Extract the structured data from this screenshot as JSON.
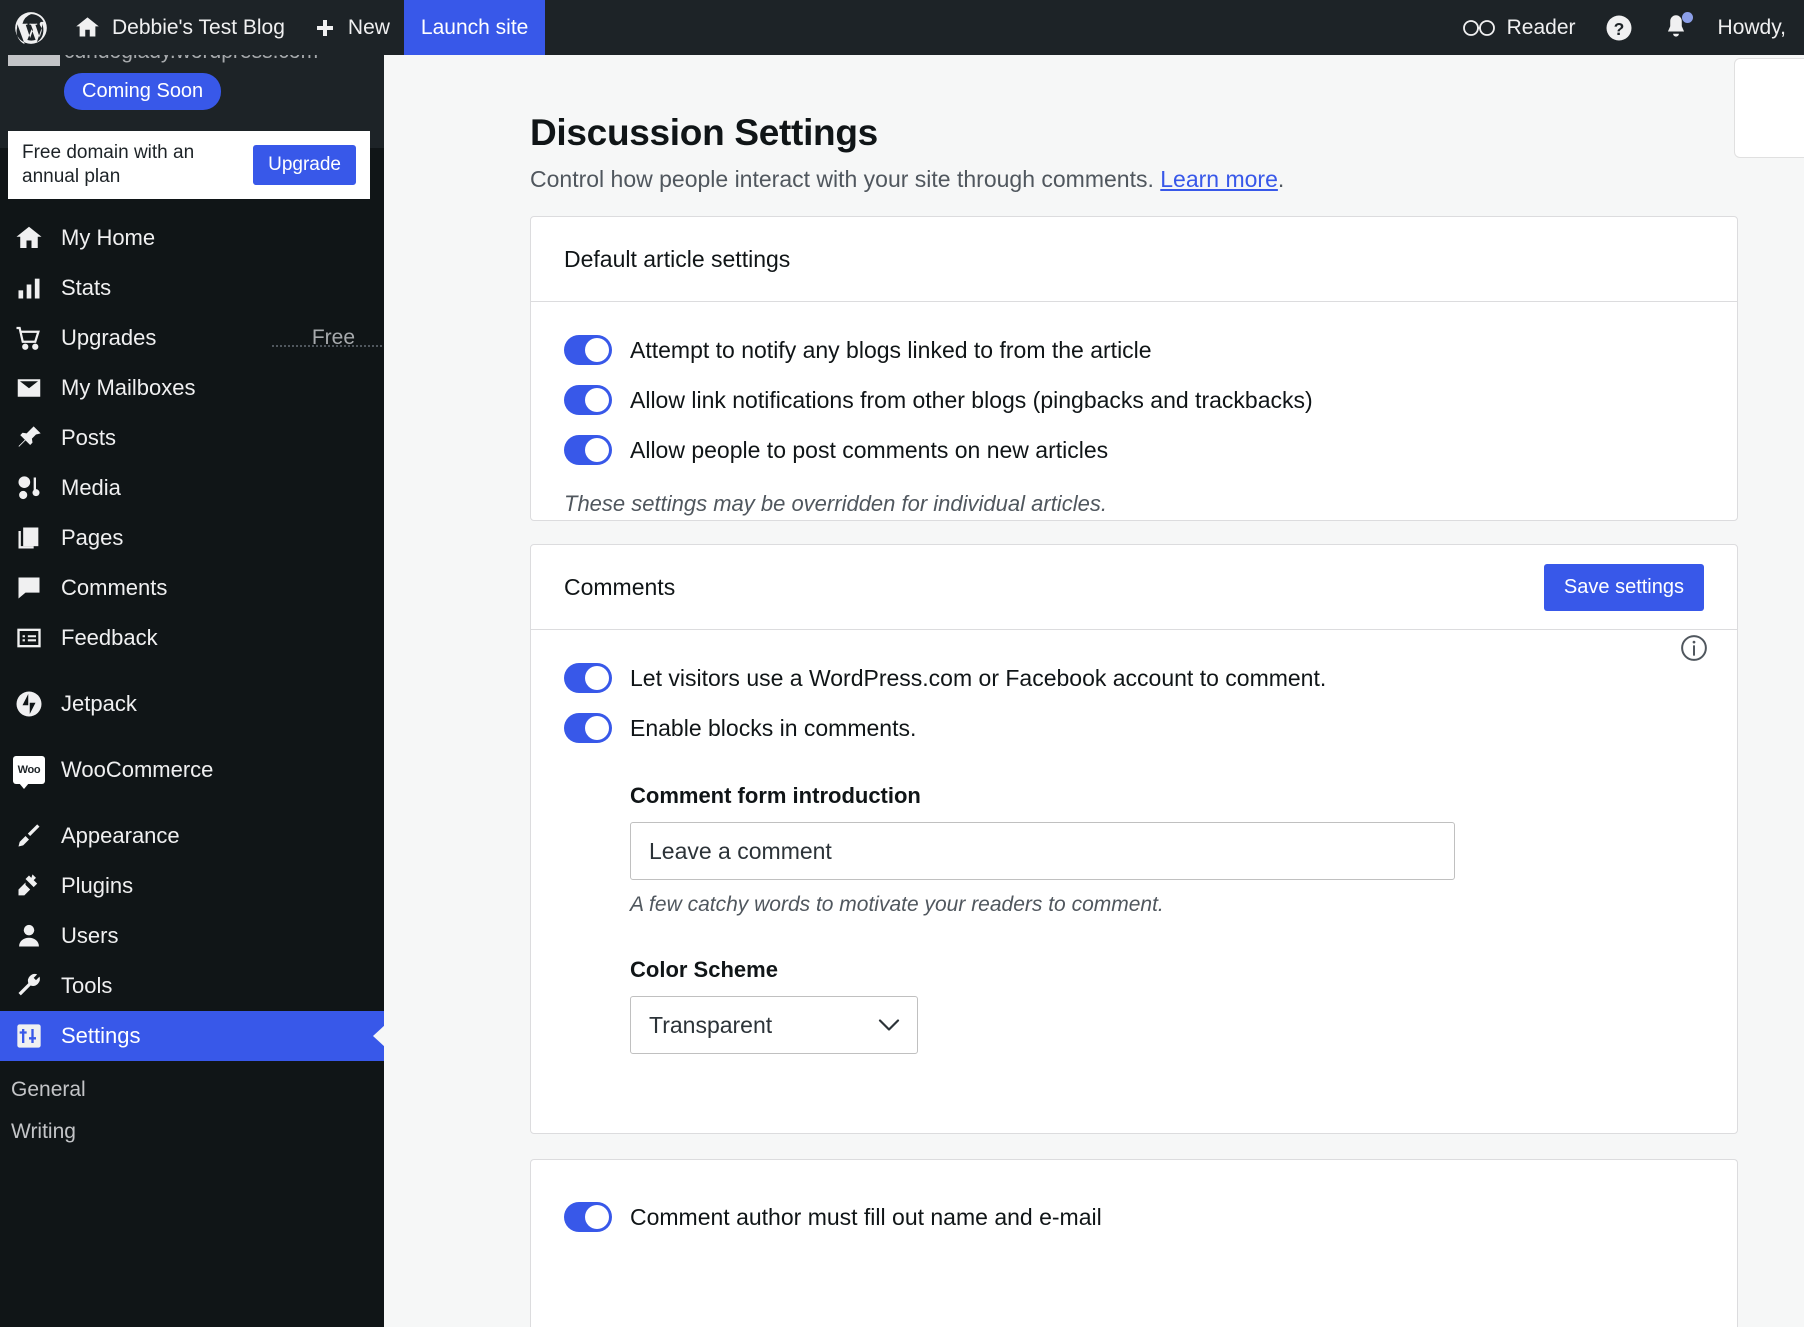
{
  "adminbar": {
    "wp_logo": "wordpress-logo",
    "site_name": "Debbie's Test Blog",
    "new_label": "New",
    "launch_label": "Launch site",
    "reader_label": "Reader",
    "howdy_label": "Howdy,"
  },
  "sidebar": {
    "site_url": "cdndoglady.wordpress.com",
    "coming_soon": "Coming Soon",
    "promo": {
      "text": "Free domain with an annual plan",
      "button": "Upgrade"
    },
    "items": [
      {
        "label": "My Home",
        "icon": "home-icon",
        "count": ""
      },
      {
        "label": "Stats",
        "icon": "stats-icon",
        "count": ""
      },
      {
        "label": "Upgrades",
        "icon": "cart-icon",
        "count": "Free"
      },
      {
        "label": "My Mailboxes",
        "icon": "mail-icon",
        "count": ""
      },
      {
        "label": "Posts",
        "icon": "pin-icon",
        "count": ""
      },
      {
        "label": "Media",
        "icon": "media-icon",
        "count": ""
      },
      {
        "label": "Pages",
        "icon": "pages-icon",
        "count": ""
      },
      {
        "label": "Comments",
        "icon": "comment-icon",
        "count": ""
      },
      {
        "label": "Feedback",
        "icon": "feedback-icon",
        "count": ""
      },
      {
        "label": "Jetpack",
        "icon": "jetpack-icon",
        "count": ""
      },
      {
        "label": "WooCommerce",
        "icon": "woo-icon",
        "count": ""
      },
      {
        "label": "Appearance",
        "icon": "brush-icon",
        "count": ""
      },
      {
        "label": "Plugins",
        "icon": "plug-icon",
        "count": ""
      },
      {
        "label": "Users",
        "icon": "user-icon",
        "count": ""
      },
      {
        "label": "Tools",
        "icon": "wrench-icon",
        "count": ""
      },
      {
        "label": "Settings",
        "icon": "settings-icon",
        "count": ""
      }
    ],
    "submenu": [
      {
        "label": "General"
      },
      {
        "label": "Writing"
      }
    ]
  },
  "page": {
    "title": "Discussion Settings",
    "subtitle": "Control how people interact with your site through comments.",
    "learn_more": "Learn more",
    "subtitle_period": "."
  },
  "default_article": {
    "heading": "Default article settings",
    "toggles": [
      {
        "label": "Attempt to notify any blogs linked to from the article",
        "on": true
      },
      {
        "label": "Allow link notifications from other blogs (pingbacks and trackbacks)",
        "on": true
      },
      {
        "label": "Allow people to post comments on new articles",
        "on": true
      }
    ],
    "note": "These settings may be overridden for individual articles."
  },
  "comments": {
    "heading": "Comments",
    "save_label": "Save settings",
    "info_icon": "info-icon",
    "toggles": [
      {
        "label": "Let visitors use a WordPress.com or Facebook account to comment.",
        "on": true
      },
      {
        "label": "Enable blocks in comments.",
        "on": true
      }
    ],
    "form_intro": {
      "label": "Comment form introduction",
      "value": "Leave a comment",
      "placeholder": "Leave a comment",
      "help": "A few catchy words to motivate your readers to comment."
    },
    "color_scheme": {
      "label": "Color Scheme",
      "selected": "Transparent",
      "options": [
        "Transparent"
      ]
    }
  },
  "comment_rules": {
    "toggles": [
      {
        "label": "Comment author must fill out name and e-mail",
        "on": true
      }
    ]
  },
  "colors": {
    "accent": "#3858e9",
    "sidebar_bg": "#101517",
    "adminbar_bg": "#1d2327",
    "page_bg": "#f6f7f7"
  }
}
